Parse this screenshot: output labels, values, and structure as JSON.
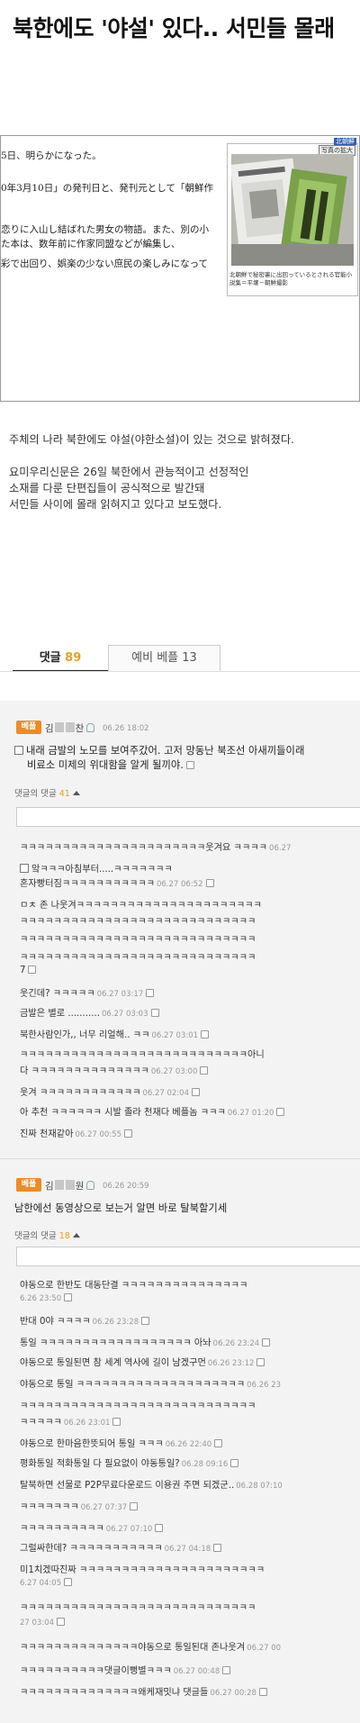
{
  "article": {
    "title": "북한에도 '야설' 있다.. 서민들 몰래",
    "jp_lines": [
      "5日、明らかになった。",
      "0年3月10日」の発刊日と、発刊元として「朝鮮作",
      "恋りに入山し結ばれた男女の物語。また、別の小",
      "た本は、数年前に作家同盟などが編集し、",
      "彩で出回り、娯楽の少ない庶民の楽しみになって"
    ],
    "photo": {
      "badge": "北朝鮮",
      "enlarge": "写真の拡大",
      "caption": "北朝鮮で秘密裏に出回っているとされる官能小説集＝平壌－朝鮮撮影"
    },
    "paragraphs": [
      "주체의 나라 북한에도 야설(야한소설)이 있는 것으로 밝혀졌다.",
      "요미우리신문은 26일 북한에서 관능적이고 선정적인",
      "소재를 다룬 단편집들이 공식적으로 발간돼",
      "서민들 사이에 몰래 읽혀지고 있다고 보도했다."
    ]
  },
  "tabs": {
    "comments_label": "댓글",
    "comments_count": "89",
    "preliminary_label": "예비 베플 13"
  },
  "comments": [
    {
      "badge": "베플",
      "nick_a": "김",
      "nick_b": "찬",
      "date": "06.26 18:02",
      "text": "내래 금발의 노모를 보여주갔어. 고저 망동난 북조선 아새끼들이래",
      "text2": "비료소 미제의 위대함을 알게 될끼야.",
      "reply_label": "댓글의 댓글",
      "reply_count": "41",
      "replies": [
        {
          "t": "ㅋㅋㅋㅋㅋㅋㅋㅋㅋㅋㅋㅋㅋㅋㅋㅋㅋㅋㅋㅋㅋㅋ웃겨요 ㅋㅋㅋㅋ",
          "d": "06.27"
        },
        {
          "t": "앜ㅋㅋㅋ아침부터.....ㅋㅋㅋㅋㅋㅋㅋ",
          "d": ""
        },
        {
          "t": "혼자빵터짐ㅋㅋㅋㅋㅋㅋㅋㅋㅋㅋㅋ",
          "d": "06.27 06:52"
        },
        {
          "t": "ㅁㅊ 존 나웃겨ㅋㅋㅋㅋㅋㅋㅋㅋㅋㅋㅋㅋㅋㅋㅋㅋㅋㅋㅋㅋㅋㅋ",
          "d": ""
        },
        {
          "t": "ㅋㅋㅋㅋㅋㅋㅋㅋㅋㅋㅋㅋㅋㅋㅋㅋㅋㅋㅋㅋㅋㅋㅋㅋㅋㅋㅋㅋ",
          "d": ""
        },
        {
          "t": "ㅋㅋㅋㅋㅋㅋㅋㅋㅋㅋㅋㅋㅋㅋㅋㅋㅋㅋㅋㅋㅋㅋㅋㅋㅋㅋㅋㅋ",
          "d": ""
        },
        {
          "t": "ㅋㅋㅋㅋㅋㅋㅋㅋㅋㅋㅋㅋㅋㅋㅋㅋㅋㅋㅋㅋㅋㅋㅋㅋㅋㅋㅋㅋ",
          "d": ""
        },
        {
          "t": "7",
          "d": ""
        },
        {
          "t": "웃긴데? ㅋㅋㅋㅋㅋ",
          "d": "06.27 03:17"
        },
        {
          "t": "금발은 별로 ...........",
          "d": "06.27 03:03"
        },
        {
          "t": "북한사람인가,, 너무 리얼해.. ㅋㅋ",
          "d": "06.27 03:01"
        },
        {
          "t": "ㅋㅋㅋㅋㅋㅋㅋㅋㅋㅋㅋㅋㅋㅋㅋㅋㅋㅋㅋㅋㅋㅋㅋㅋㅋㅋㅋ아니",
          "d": ""
        },
        {
          "t": "다 ㅋㅋㅋㅋㅋㅋㅋㅋㅋㅋㅋㅋㅋㅋ",
          "d": "06.27 03:00"
        },
        {
          "t": "웃겨 ㅋㅋㅋㅋㅋㅋㅋㅋㅋㅋㅋㅋ",
          "d": "06.27 02:04"
        },
        {
          "t": "아 추천 ㅋㅋㅋㅋㅋㅋ 시발 졸라 천재다 베플놈 ㅋㅋㅋ",
          "d": "06.27 01:20"
        },
        {
          "t": "진짜 천재같아",
          "d": "06.27 00:55"
        }
      ]
    },
    {
      "badge": "베플",
      "nick_a": "김",
      "nick_b": "원",
      "date": "06.26 20:59",
      "text": "남한에선 동영상으로 보는거 알면 바로 탈북할기세",
      "reply_label": "댓글의 댓글",
      "reply_count": "18",
      "replies": [
        {
          "t": "야동으로 한반도 대동단결 ㅋㅋㅋㅋㅋㅋㅋㅋㅋㅋㅋㅋㅋㅋㅋ",
          "d": ""
        },
        {
          "t": "6.26 23:50",
          "d": ""
        },
        {
          "t": "반대 0야 ㅋㅋㅋㅋ",
          "d": "06.26 23:28"
        },
        {
          "t": "통일 ㅋㅋㅋㅋㅋㅋㅋㅋㅋㅋㅋㅋㅋㅋㅋㅋㅋㅋ 아놔",
          "d": "06.26 23:24"
        },
        {
          "t": "야동으로 통일된면 참 세계 역사에 길이 남겠구먼",
          "d": "06.26 23:12"
        },
        {
          "t": "야동으로 통일 ㅋㅋㅋㅋㅋㅋㅋㅋㅋㅋㅋㅋㅋㅋㅋㅋㅋㅋㅋㅋ",
          "d": "06.26 23"
        },
        {
          "t": "ㅋㅋㅋㅋㅋㅋㅋㅋㅋㅋㅋㅋㅋㅋㅋㅋㅋㅋㅋㅋㅋㅋㅋㅋㅋㅋㅋㅋ",
          "d": ""
        },
        {
          "t": "ㅋㅋㅋㅋㅋ",
          "d": "06.26 23:01"
        },
        {
          "t": "야동으로 한마음한뜻되어 통일 ㅋㅋㅋ",
          "d": "06.26 22:40"
        },
        {
          "t": "평화통일 적화통일 다 필요없이 야동통일?",
          "d": "06.28 09:16"
        },
        {
          "t": "탈북하면 선물로 P2P무료다운로드 이용권 주면 되겠군..",
          "d": "06.28 07:10"
        },
        {
          "t": "ㅋㅋㅋㅋㅋㅋㅋ",
          "d": "06.27 07:37"
        },
        {
          "t": "ㅋㅋㅋㅋㅋㅋㅋㅋㅋㅋ",
          "d": "06.27 07:10"
        },
        {
          "t": "그럴싸한데? ㅋㅋㅋㅋㅋㅋㅋㅋㅋㅋㅋ",
          "d": "06.27 04:18"
        },
        {
          "t": "미1치겠따진짜 ㅋㅋㅋㅋㅋㅋㅋㅋㅋㅋㅋㅋㅋㅋㅋㅋㅋㅋㅋㅋㅋㅋ",
          "d": ""
        },
        {
          "t": "6.27 04:05",
          "d": ""
        },
        {
          "t": "ㅋㅋㅋㅋㅋㅋㅋㅋㅋㅋㅋㅋㅋㅋㅋㅋㅋㅋㅋㅋㅋㅋㅋㅋㅋㅋㅋㅋ",
          "d": ""
        },
        {
          "t": "27 03:04",
          "d": ""
        },
        {
          "t": "ㅋㅋㅋㅋㅋㅋㅋㅋㅋㅋㅋㅋㅋㅋ야동으로 통일된대 존나웃겨",
          "d": "06.27 00"
        },
        {
          "t": "ㅋㅋㅋㅋㅋㅋㅋㅋㅋㅋ댓글이뻥별ㅋㅋㅋ",
          "d": "06.27 00:48"
        },
        {
          "t": "ㅋㅋㅋㅋㅋㅋㅋㅋㅋㅋㅋㅋㅋㅋ왜케재밋냐 댓글들",
          "d": "06.27 00:28"
        }
      ]
    }
  ]
}
